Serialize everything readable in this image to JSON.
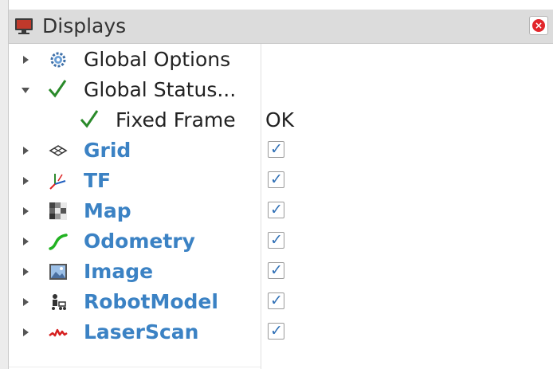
{
  "panel": {
    "title": "Displays",
    "close_icon": "close-icon"
  },
  "tree": {
    "global_options": {
      "label": "Global Options",
      "icon": "gear-icon"
    },
    "global_status": {
      "label": "Global Status...",
      "icon": "checkmark-icon"
    },
    "fixed_frame": {
      "label": "Fixed Frame",
      "value": "OK",
      "icon": "checkmark-icon"
    },
    "displays": [
      {
        "label": "Grid",
        "icon": "grid-icon",
        "checked": true
      },
      {
        "label": "TF",
        "icon": "tf-axes-icon",
        "checked": true
      },
      {
        "label": "Map",
        "icon": "map-icon",
        "checked": true
      },
      {
        "label": "Odometry",
        "icon": "odometry-icon",
        "checked": true
      },
      {
        "label": "Image",
        "icon": "image-icon",
        "checked": true
      },
      {
        "label": "RobotModel",
        "icon": "robot-model-icon",
        "checked": true
      },
      {
        "label": "LaserScan",
        "icon": "laser-scan-icon",
        "checked": true
      }
    ]
  },
  "colors": {
    "display_label": "#3b82c4",
    "check_green": "#2a8a2a",
    "checkbox_tick": "#2f6fb5"
  }
}
